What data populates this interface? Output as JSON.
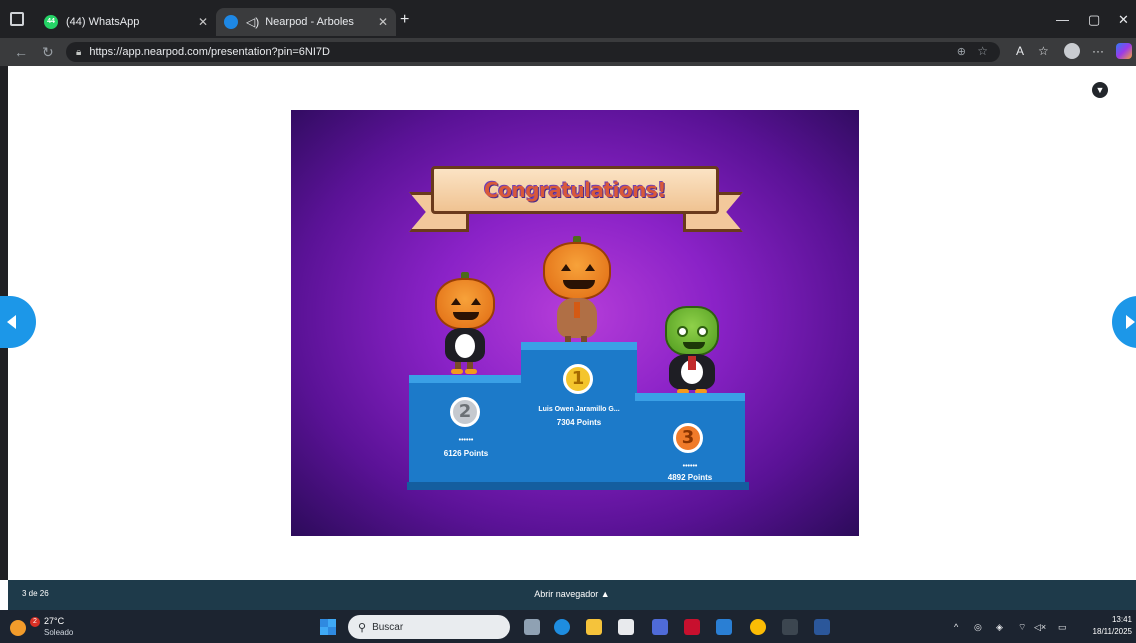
{
  "tabs": [
    {
      "title": "(44) WhatsApp",
      "badge": "44"
    },
    {
      "title": "Nearpod - Arboles"
    }
  ],
  "address": {
    "url": "https://app.nearpod.com/presentation?pin=6NI7D"
  },
  "slide": {
    "banner_text": "Congratulations!",
    "podium": {
      "first": {
        "rank": "1",
        "name": "Luis Owen Jaramillo G...",
        "points": "7304 Points"
      },
      "second": {
        "rank": "2",
        "name": "••••••",
        "points": "6126 Points"
      },
      "third": {
        "rank": "3",
        "name": "••••••",
        "points": "4892 Points"
      }
    }
  },
  "bottombar": {
    "page_counter": "3 de 26",
    "open_button": "Abrir navegador ▲"
  },
  "taskbar": {
    "weather": {
      "temp": "27°C",
      "condition": "Soleado",
      "badge": "2"
    },
    "search_placeholder": "Buscar",
    "clock": {
      "time": "13:41",
      "date": "18/11/2025"
    }
  },
  "colors": {
    "accent": "#1c97e8",
    "slide_bg": "#8a22c7",
    "podium": "#1c7ac9"
  }
}
